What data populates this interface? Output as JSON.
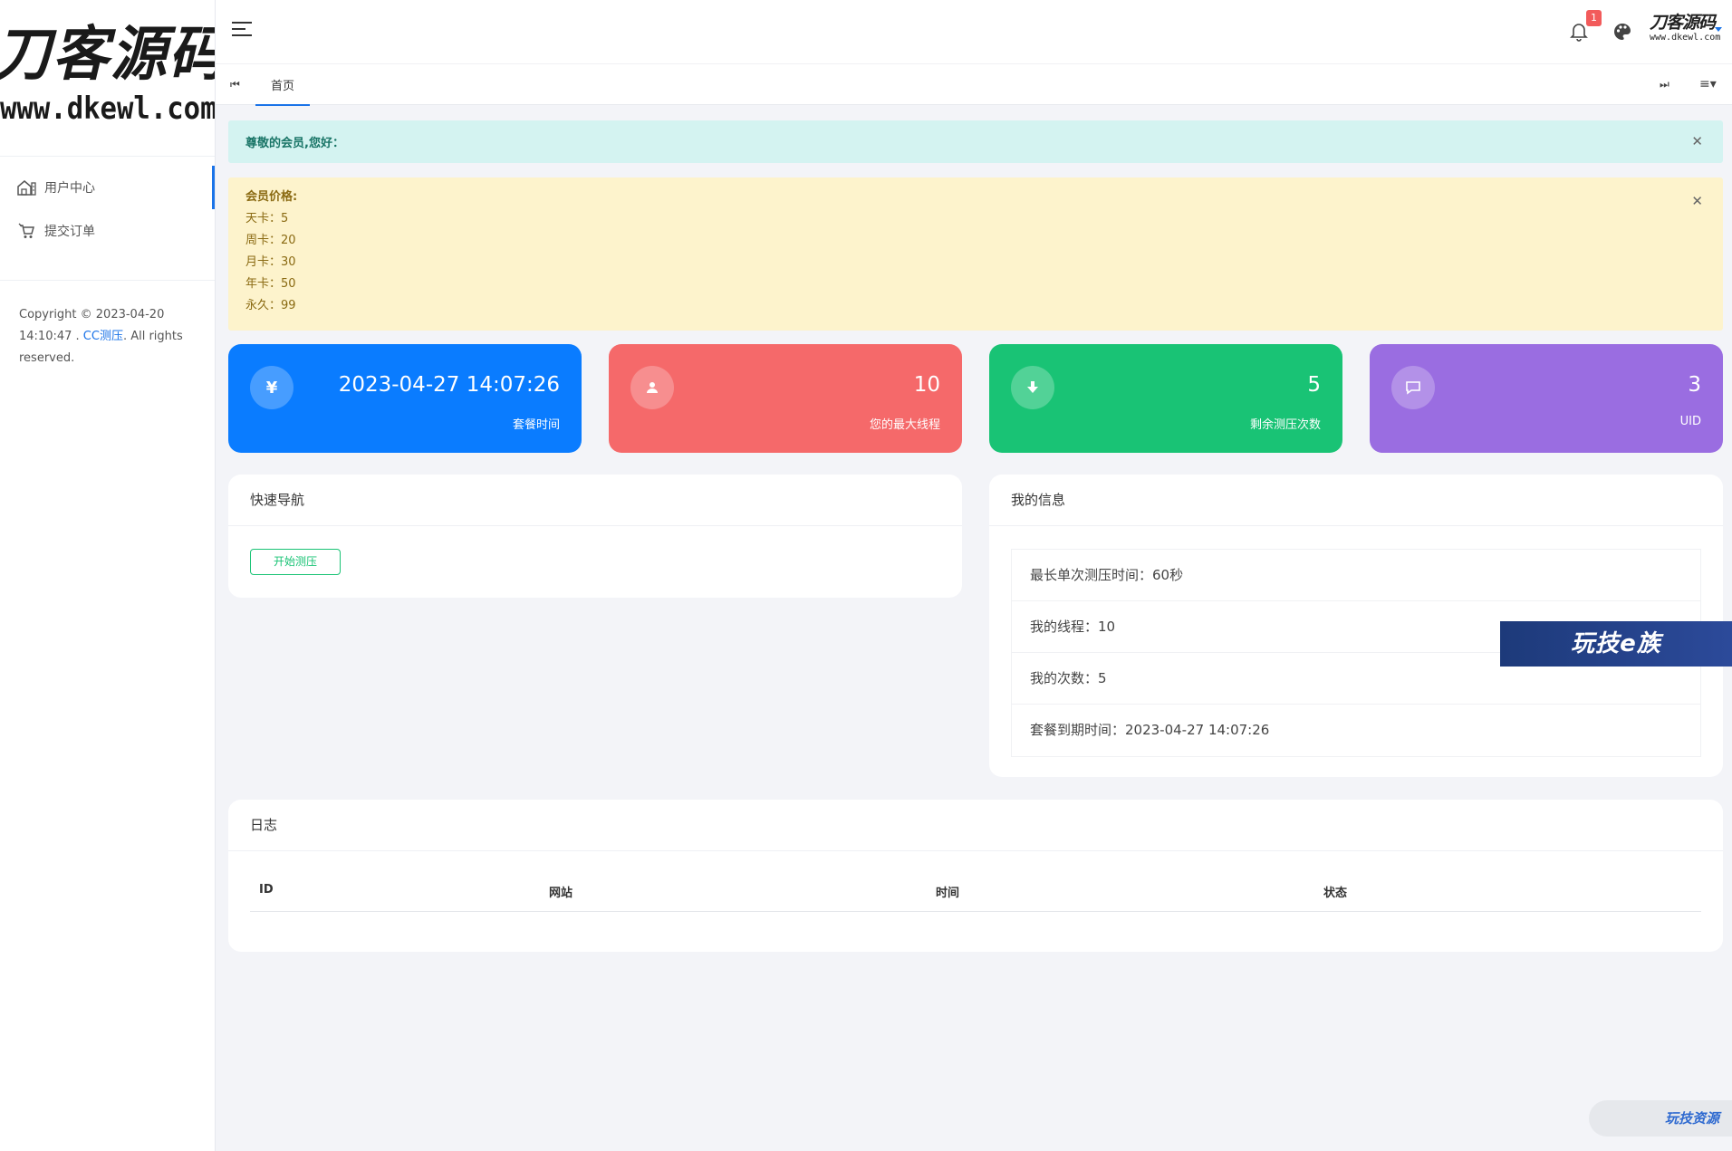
{
  "brand": {
    "logo_line1": "刀客源码网",
    "logo_line2": "www.dkewl.com"
  },
  "sidebar": {
    "items": [
      {
        "label": "用户中心",
        "icon": "home-icon",
        "active": true
      },
      {
        "label": "提交订单",
        "icon": "cart-icon",
        "active": false
      }
    ],
    "copyright_prefix": "Copyright © 2023-04-20 14:10:47 .",
    "copyright_link": "CC测压",
    "copyright_suffix": ". All rights reserved."
  },
  "header": {
    "notification_count": "1",
    "avatar_line1": "刀客源码",
    "avatar_line2": "www.dkewl.com"
  },
  "tabs": {
    "home_label": "首页",
    "prev_icon": "⏮",
    "next_icon": "⏭",
    "menu_icon": "≡▾"
  },
  "alerts": {
    "welcome": "尊敬的会员,您好：",
    "price_title": "会员价格:",
    "prices": [
      "天卡：5",
      "周卡：20",
      "月卡：30",
      "年卡：50",
      "永久：99"
    ]
  },
  "stats": [
    {
      "icon": "¥",
      "icon_name": "yen-icon",
      "value": "2023-04-27 14:07:26",
      "label": "套餐时间",
      "color": "#0a7cff"
    },
    {
      "icon": "user",
      "icon_name": "user-icon",
      "value": "10",
      "label": "您的最大线程",
      "color": "#f5696a"
    },
    {
      "icon": "down",
      "icon_name": "download-icon",
      "value": "5",
      "label": "剩余测压次数",
      "color": "#19c375"
    },
    {
      "icon": "chat",
      "icon_name": "chat-icon",
      "value": "3",
      "label": "UID",
      "color": "#9a6de1"
    }
  ],
  "quick_nav": {
    "title": "快速导航",
    "button": "开始测压"
  },
  "my_info": {
    "title": "我的信息",
    "rows": [
      "最长单次测压时间：60秒",
      "我的线程：10",
      "我的次数：5",
      "套餐到期时间：2023-04-27 14:07:26"
    ]
  },
  "log": {
    "title": "日志",
    "columns": [
      "ID",
      "网站",
      "时间",
      "状态"
    ]
  },
  "watermarks": {
    "wm1": "玩技e族",
    "wm2": "玩技资源"
  }
}
